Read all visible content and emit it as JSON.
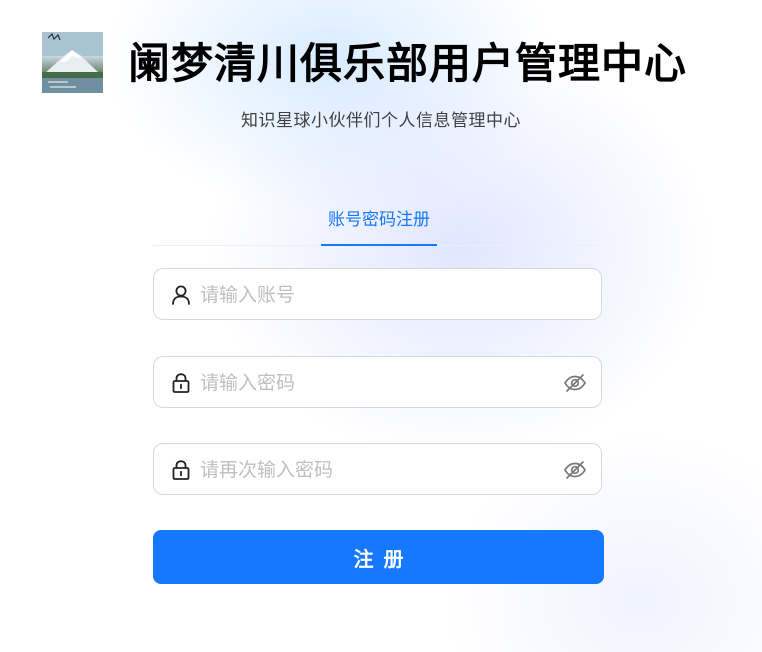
{
  "header": {
    "logo_icon": "snow-mountain-lake-icon",
    "title": "阑梦清川俱乐部用户管理中心",
    "subtitle": "知识星球小伙伴们个人信息管理中心"
  },
  "tabs": [
    {
      "label": "账号密码注册",
      "active": true
    }
  ],
  "form": {
    "account": {
      "placeholder": "请输入账号",
      "value": "",
      "icon": "user-icon"
    },
    "password": {
      "placeholder": "请输入密码",
      "value": "",
      "icon": "lock-icon",
      "toggle_icon": "eye-invisible-icon"
    },
    "confirm_password": {
      "placeholder": "请再次输入密码",
      "value": "",
      "icon": "lock-icon",
      "toggle_icon": "eye-invisible-icon"
    },
    "submit_label": "注册"
  },
  "colors": {
    "primary": "#1677ff",
    "title": "#000000",
    "placeholder": "#bfbfbf",
    "border": "#d9d9d9"
  }
}
